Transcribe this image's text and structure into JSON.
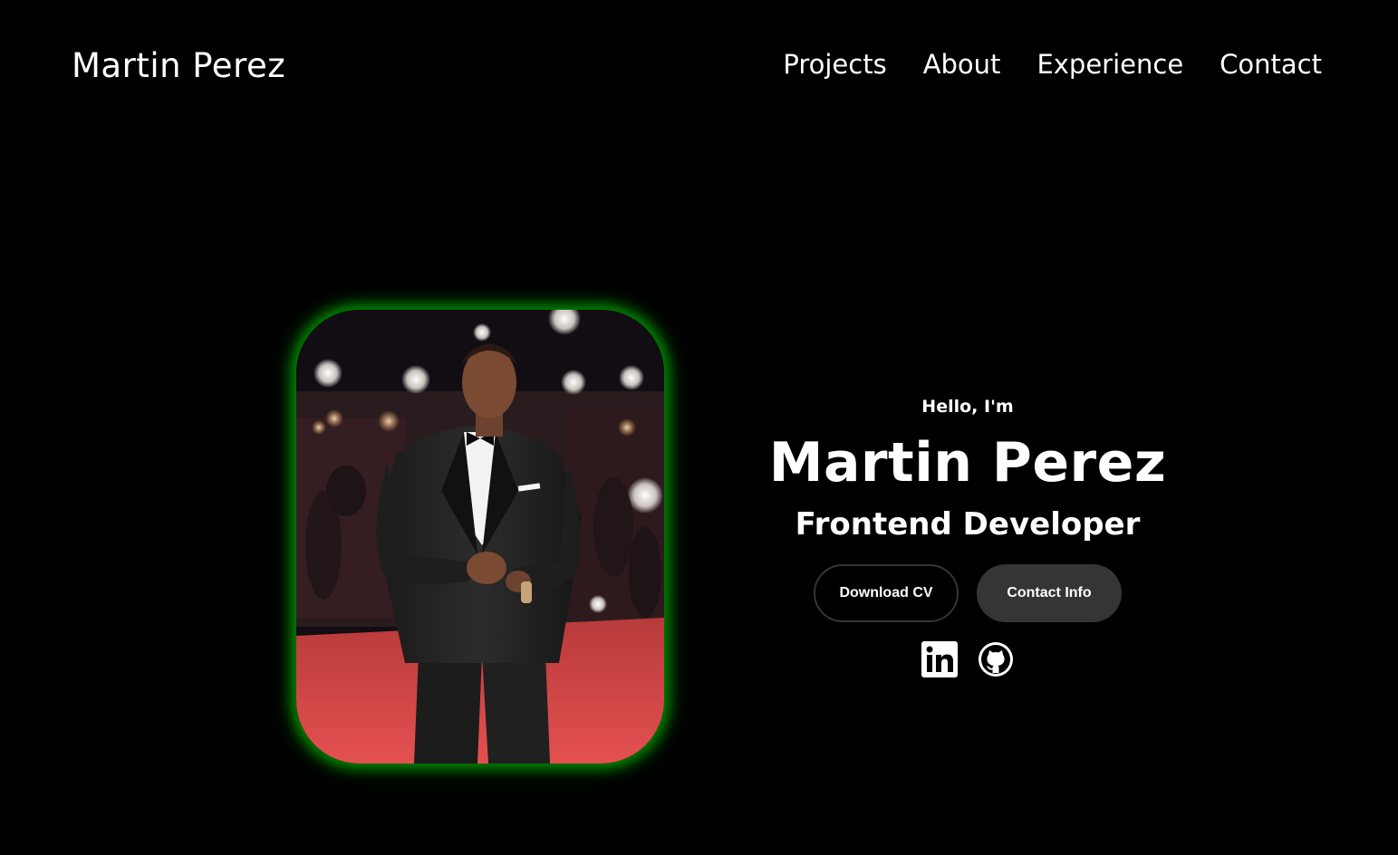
{
  "header": {
    "logo": "Martin Perez",
    "nav": [
      {
        "label": "Projects"
      },
      {
        "label": "About"
      },
      {
        "label": "Experience"
      },
      {
        "label": "Contact"
      }
    ]
  },
  "hero": {
    "greeting": "Hello, I'm",
    "name": "Martin Perez",
    "role": "Frontend Developer",
    "buttons": {
      "download_cv": "Download CV",
      "contact_info": "Contact Info"
    },
    "photo_alt": "Martin Perez profile picture",
    "socials": [
      {
        "icon": "linkedin-icon",
        "label": "My LinkedIn profile"
      },
      {
        "icon": "github-icon",
        "label": "My Github profile"
      }
    ]
  },
  "colors": {
    "background": "#000000",
    "text": "#ffffff",
    "button_dark": "#353535",
    "photo_glow": "#00c800"
  }
}
